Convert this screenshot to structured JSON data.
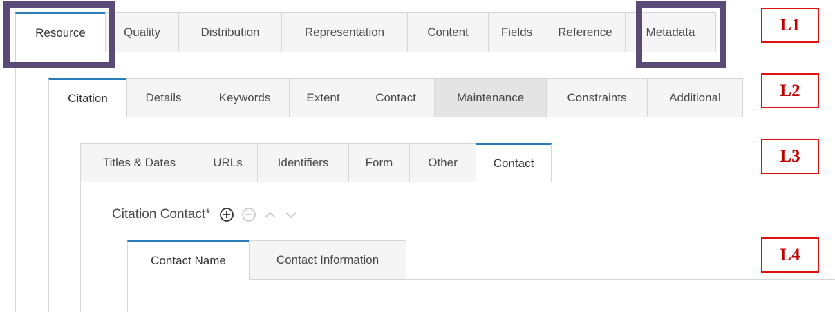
{
  "level1": {
    "tabs": [
      {
        "label": "Resource"
      },
      {
        "label": "Quality"
      },
      {
        "label": "Distribution"
      },
      {
        "label": "Representation"
      },
      {
        "label": "Content"
      },
      {
        "label": "Fields"
      },
      {
        "label": "Reference"
      },
      {
        "label": "Metadata"
      }
    ],
    "active": "Resource"
  },
  "level2": {
    "tabs": [
      {
        "label": "Citation"
      },
      {
        "label": "Details"
      },
      {
        "label": "Keywords"
      },
      {
        "label": "Extent"
      },
      {
        "label": "Contact"
      },
      {
        "label": "Maintenance"
      },
      {
        "label": "Constraints"
      },
      {
        "label": "Additional"
      }
    ],
    "active": "Citation",
    "hovered": "Maintenance"
  },
  "level3": {
    "tabs": [
      {
        "label": "Titles & Dates"
      },
      {
        "label": "URLs"
      },
      {
        "label": "Identifiers"
      },
      {
        "label": "Form"
      },
      {
        "label": "Other"
      },
      {
        "label": "Contact"
      }
    ],
    "active": "Contact"
  },
  "citation_contact": {
    "label": "Citation Contact*",
    "icons": [
      "add-circle-icon",
      "remove-circle-icon",
      "chevron-up-icon",
      "chevron-down-icon"
    ]
  },
  "level4": {
    "tabs": [
      {
        "label": "Contact Name"
      },
      {
        "label": "Contact Information"
      }
    ],
    "active": "Contact Name"
  },
  "level_labels": {
    "l1": "L1",
    "l2": "L2",
    "l3": "L3",
    "l4": "L4"
  },
  "colors": {
    "active_tab_accent": "#2b7bb9",
    "highlight_box": "#5a4a78",
    "level_label": "#c00000"
  }
}
